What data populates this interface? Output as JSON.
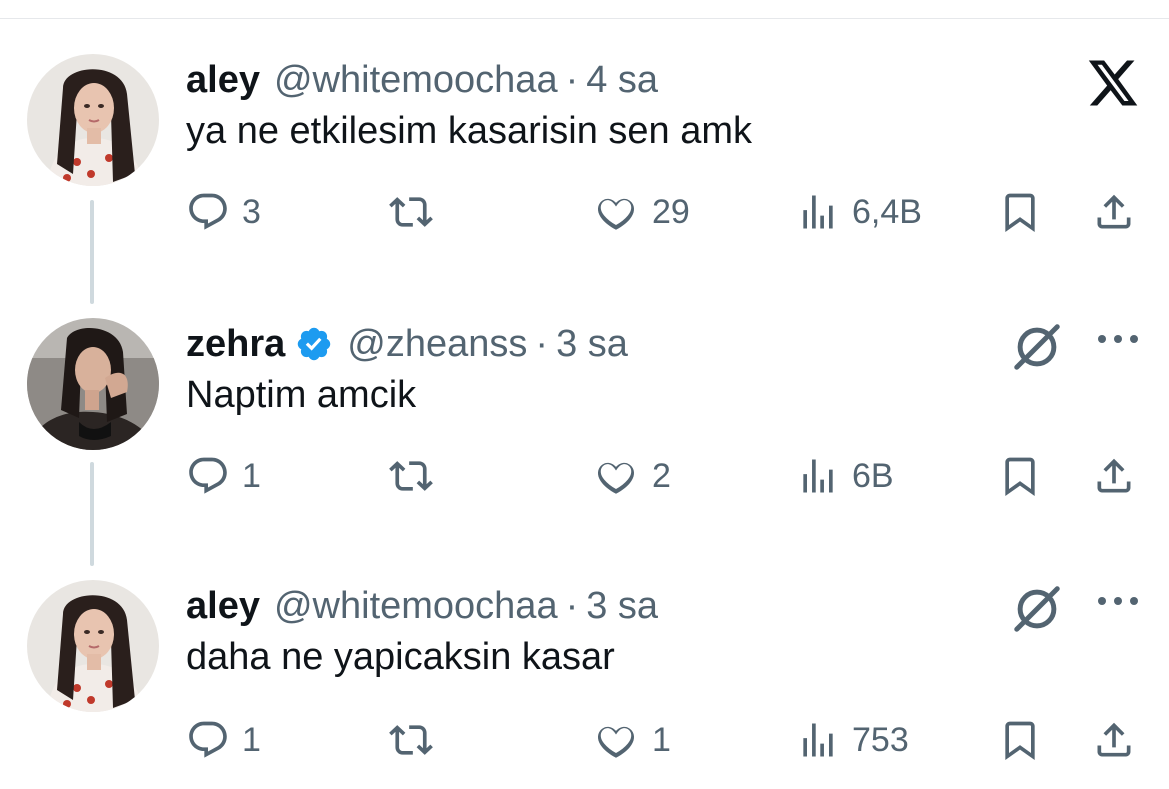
{
  "tweets": [
    {
      "name": "aley",
      "handle": "@whitemoochaa",
      "separator": "·",
      "time": "4 sa",
      "text": "ya ne etkilesim kasarisin sen amk",
      "verified": false,
      "top_right_icon": "x-logo-icon",
      "replies": "3",
      "retweets": "",
      "likes": "29",
      "views": "6,4B"
    },
    {
      "name": "zehra",
      "handle": "@zheanss",
      "separator": "·",
      "time": "3 sa",
      "text": "Naptim amcik",
      "verified": true,
      "top_right_icon": "grok-icon",
      "more_icon": "more-dots-icon",
      "replies": "1",
      "retweets": "",
      "likes": "2",
      "views": "6B"
    },
    {
      "name": "aley",
      "handle": "@whitemoochaa",
      "separator": "·",
      "time": "3 sa",
      "text": "daha ne yapicaksin kasar",
      "verified": false,
      "top_right_icon": "grok-icon",
      "more_icon": "more-dots-icon",
      "replies": "1",
      "retweets": "",
      "likes": "1",
      "views": "753"
    }
  ],
  "colors": {
    "text_primary": "#0f1419",
    "text_secondary": "#536471",
    "verified_blue": "#1d9bf0",
    "thread_line": "#cfd9de"
  },
  "icons": [
    "reply-icon",
    "retweet-icon",
    "like-icon",
    "views-icon",
    "bookmark-icon",
    "share-icon",
    "verified-badge-icon"
  ]
}
